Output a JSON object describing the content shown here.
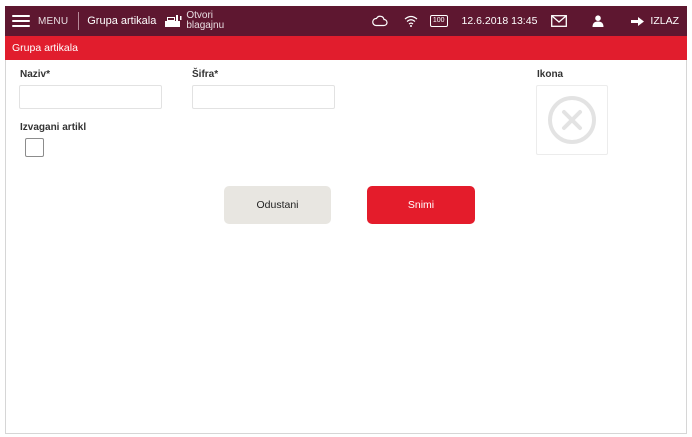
{
  "topbar": {
    "menu_label": "MENU",
    "breadcrumb": "Grupa artikala",
    "register_label": "Otvori blagajnu",
    "battery_level": "100",
    "datetime": "12.6.2018 13:45",
    "exit_label": "IZLAZ"
  },
  "page": {
    "title": "Grupa artikala"
  },
  "form": {
    "name_label": "Naziv*",
    "name_value": "",
    "code_label": "Šifra*",
    "code_value": "",
    "icon_label": "Ikona",
    "weighed_label": "Izvagani artikl",
    "weighed_checked": false
  },
  "buttons": {
    "cancel_label": "Odustani",
    "save_label": "Snimi"
  },
  "colors": {
    "topbar_bg": "#5e1730",
    "accent_red": "#e11d2d",
    "cancel_bg": "#e8e6e1"
  },
  "icons": [
    "menu-icon",
    "cash-register-icon",
    "cloud-sync-icon",
    "wifi-icon",
    "battery-icon",
    "mail-icon",
    "user-icon",
    "arrow-right-icon",
    "empty-icon-placeholder"
  ]
}
